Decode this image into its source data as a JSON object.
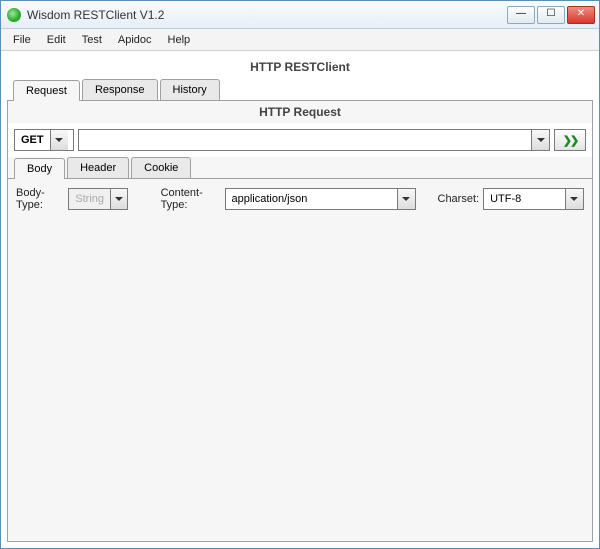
{
  "window": {
    "title": "Wisdom RESTClient V1.2"
  },
  "menubar": {
    "items": [
      "File",
      "Edit",
      "Test",
      "Apidoc",
      "Help"
    ]
  },
  "panel": {
    "title": "HTTP RESTClient",
    "tabs": [
      "Request",
      "Response",
      "History"
    ],
    "active_tab": "Request"
  },
  "request": {
    "title": "HTTP Request",
    "method": "GET",
    "url": "",
    "send_glyph": "❯❯",
    "sub_tabs": [
      "Body",
      "Header",
      "Cookie"
    ],
    "active_sub": "Body",
    "body": {
      "body_type_label": "Body-Type:",
      "body_type_value": "String",
      "content_type_label": "Content-Type:",
      "content_type_value": "application/json",
      "charset_label": "Charset:",
      "charset_value": "UTF-8"
    }
  }
}
